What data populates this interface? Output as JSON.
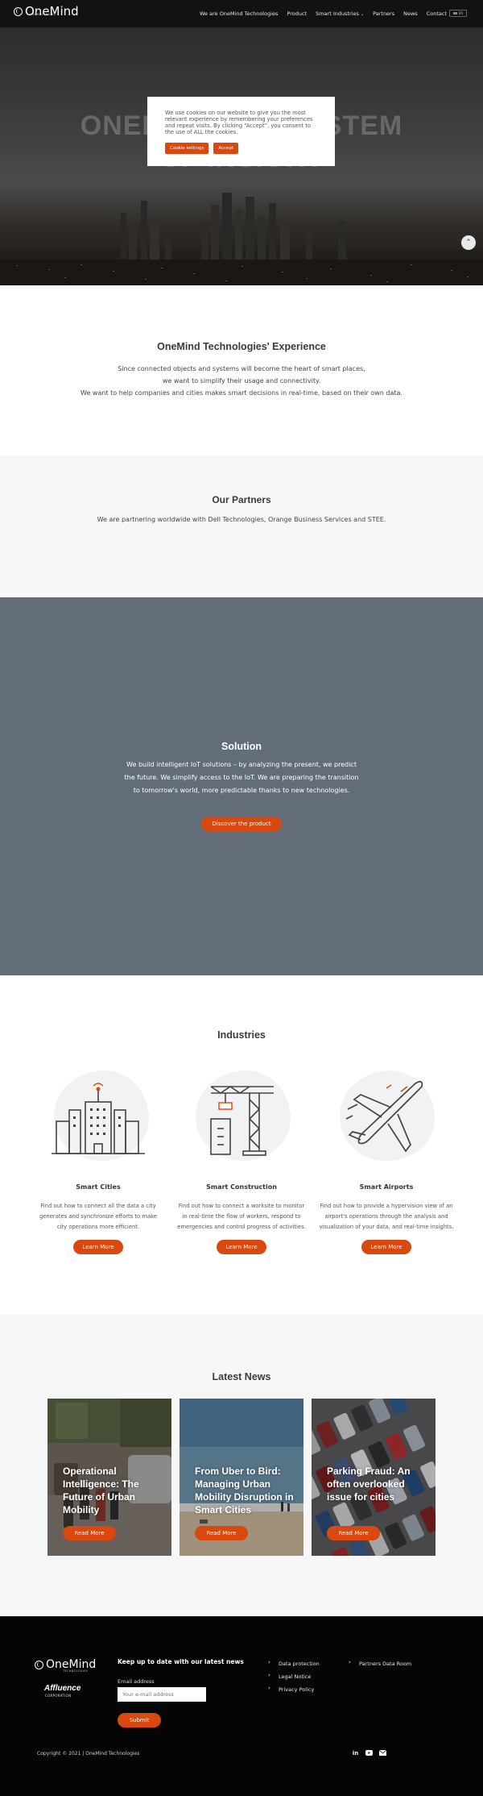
{
  "header": {
    "logo_text": "OneMind",
    "logo_sub": "TECHNOLOGIES",
    "nav": [
      "We are OneMind Technologies",
      "Product",
      "Smart Industries",
      "Partners",
      "News",
      "Contact"
    ],
    "lang": "EN"
  },
  "hero": {
    "title_line1": "ONEMIND ECOSYSTEM",
    "title_line2": "OF INSIGHT",
    "cookie_text": "We use cookies on our website to give you the most relevant experience by remembering your preferences and repeat visits. By clicking “Accept”, you consent to the use of ALL the cookies.",
    "cookie_settings": "Cookie settings",
    "accept": "Accept"
  },
  "experience": {
    "title": "OneMind Technologies' Experience",
    "line1": "Since connected objects and systems will become the heart of smart places,",
    "line2": "we want to simplify their usage and connectivity.",
    "line3": "We want to help companies and cities makes smart decisions in real-time, based on their own data."
  },
  "partners": {
    "title": "Our Partners",
    "text": "We are partnering worldwide with Dell Technologies, Orange Business Services and STEE."
  },
  "solution": {
    "title": "Solution",
    "line1": "We build intelligent IoT solutions – by analyzing the present, we predict",
    "line2": "the future. We simplify access to the IoT.  We are preparing the transition",
    "line3": "to tomorrow's world, more predictable thanks to new technologies.",
    "button": "Discover the product"
  },
  "industries": {
    "title": "Industries",
    "cards": [
      {
        "title": "Smart Cities",
        "l1": "Find out how to connect all the data a city",
        "l2": "generates and synchronize efforts to make",
        "l3": "city operations more efficient.",
        "button": "Learn More"
      },
      {
        "title": "Smart Construction",
        "l1": "Find out how to connect a worksite to monitor",
        "l2": "in real-time the flow of workers, respond to",
        "l3": "emergencies and control progress of activities.",
        "button": "Learn More"
      },
      {
        "title": "Smart Airports",
        "l1": "Find out how to provide a hypervision view of an",
        "l2": "airport's operations through the analysis and",
        "l3": "visualization of your data, and real-time insights.",
        "button": "Learn More"
      }
    ]
  },
  "news": {
    "title": "Latest News",
    "cards": [
      {
        "title": "Operational Intelligence: The Future of Urban Mobility",
        "button": "Read More"
      },
      {
        "title": "From Uber to Bird: Managing Urban Mobility Disruption in Smart Cities",
        "button": "Read More"
      },
      {
        "title": "Parking Fraud: An often overlooked issue for cities",
        "button": "Read More"
      }
    ]
  },
  "footer": {
    "logo_text": "OneMind",
    "logo_sub": "TECHNOLOGIES",
    "affluence": "Affluence",
    "affluence_sub": "CORPORATION",
    "newsletter_title": "Keep up to date with our latest news",
    "email_label": "Email address",
    "email_placeholder": "Your e-mail address",
    "submit": "Submit",
    "links1": [
      "Data protection",
      "Legal Notice",
      "Privacy Policy"
    ],
    "links2": [
      "Partners Data Room"
    ],
    "copyright": "Copyright © 2021 | OneMind Technologies"
  },
  "colors": {
    "accent": "#d9480f",
    "solution_bg": "#626d78",
    "footer_bg": "#050505"
  }
}
